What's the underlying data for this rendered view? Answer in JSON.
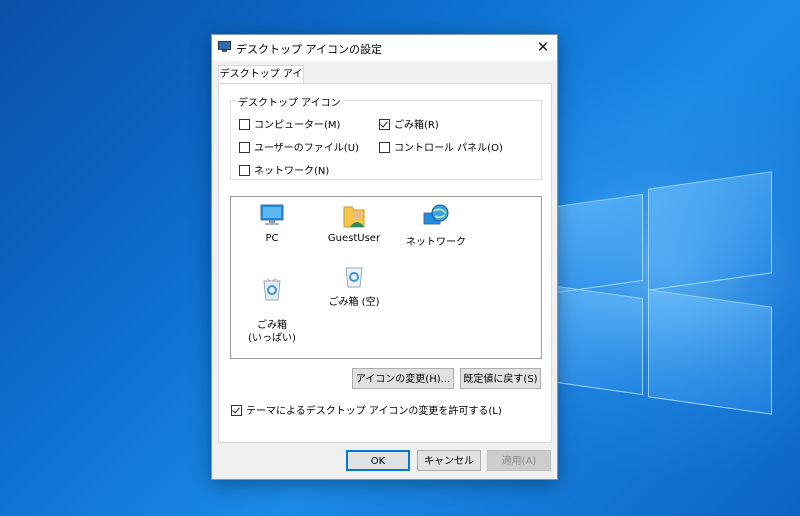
{
  "dialog": {
    "title": "デスクトップ アイコンの設定",
    "close_glyph": "✕"
  },
  "tab": {
    "label": "デスクトップ アイコン"
  },
  "group": {
    "label": "デスクトップ アイコン",
    "checkboxes": [
      {
        "label": "コンピューター(M)",
        "checked": false
      },
      {
        "label": "ごみ箱(R)",
        "checked": true
      },
      {
        "label": "ユーザーのファイル(U)",
        "checked": false
      },
      {
        "label": "コントロール パネル(O)",
        "checked": false
      },
      {
        "label": "ネットワーク(N)",
        "checked": false
      }
    ]
  },
  "icons": [
    {
      "label": "PC",
      "icon": "pc-icon"
    },
    {
      "label": "GuestUser",
      "icon": "user-folder-icon"
    },
    {
      "label": "ネットワーク",
      "icon": "network-icon"
    },
    {
      "label": "ごみ箱\n(いっぱい)",
      "icon": "recycle-bin-full-icon"
    },
    {
      "label": "ごみ箱 (空)",
      "icon": "recycle-bin-empty-icon"
    }
  ],
  "buttons": {
    "change_icon": "アイコンの変更(H)...",
    "restore_default": "既定値に戻す(S)",
    "ok": "OK",
    "cancel": "キャンセル",
    "apply": "適用(A)"
  },
  "theme_checkbox": {
    "label": "テーマによるデスクトップ アイコンの変更を許可する(L)",
    "checked": true
  },
  "colors": {
    "accent": "#0078d7",
    "desktop": "#0d6fd0"
  }
}
